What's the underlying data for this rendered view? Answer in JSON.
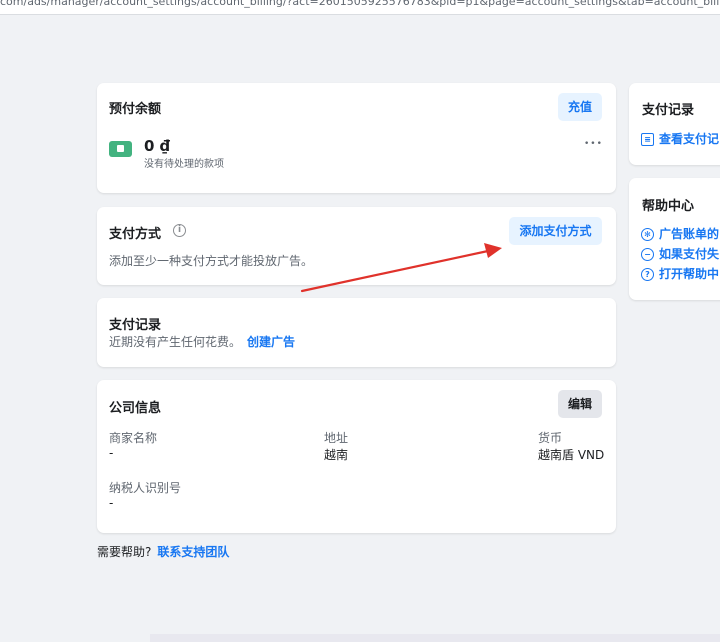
{
  "browser": {
    "url": "com/ads/manager/account_settings/account_billing/?act=2601505925576783&pid=p1&page=account_settings&tab=account_billing"
  },
  "prepaid": {
    "title": "预付余额",
    "recharge_label": "充值",
    "balance": "0 ₫",
    "pending_text": "没有待处理的款项",
    "more_label": "•••"
  },
  "payment_method": {
    "title": "支付方式",
    "add_label": "添加支付方式",
    "hint": "添加至少一种支付方式才能投放广告。"
  },
  "payment_history": {
    "title": "支付记录",
    "text": "近期没有产生任何花费。",
    "create_ad_label": "创建广告"
  },
  "company": {
    "title": "公司信息",
    "edit_label": "编辑",
    "fields": [
      {
        "label": "商家名称",
        "value": "-"
      },
      {
        "label": "地址",
        "value": "越南"
      },
      {
        "label": "货币",
        "value": "越南盾 VND"
      },
      {
        "label": "纳税人识别号",
        "value": "-"
      }
    ]
  },
  "footer": {
    "need_help": "需要帮助?",
    "contact_label": "联系支持团队"
  },
  "side_payment_history": {
    "title": "支付记录",
    "view_label": "查看支付记"
  },
  "help_center": {
    "title": "帮助中心",
    "items": [
      {
        "label": "广告账单的",
        "icon": "gear-icon"
      },
      {
        "label": "如果支付失",
        "icon": "minus-circle-icon"
      },
      {
        "label": "打开帮助中",
        "icon": "question-icon"
      }
    ]
  },
  "colors": {
    "accent": "#1877f2",
    "wallet": "#43b380",
    "annotation_arrow": "#e0322b"
  }
}
